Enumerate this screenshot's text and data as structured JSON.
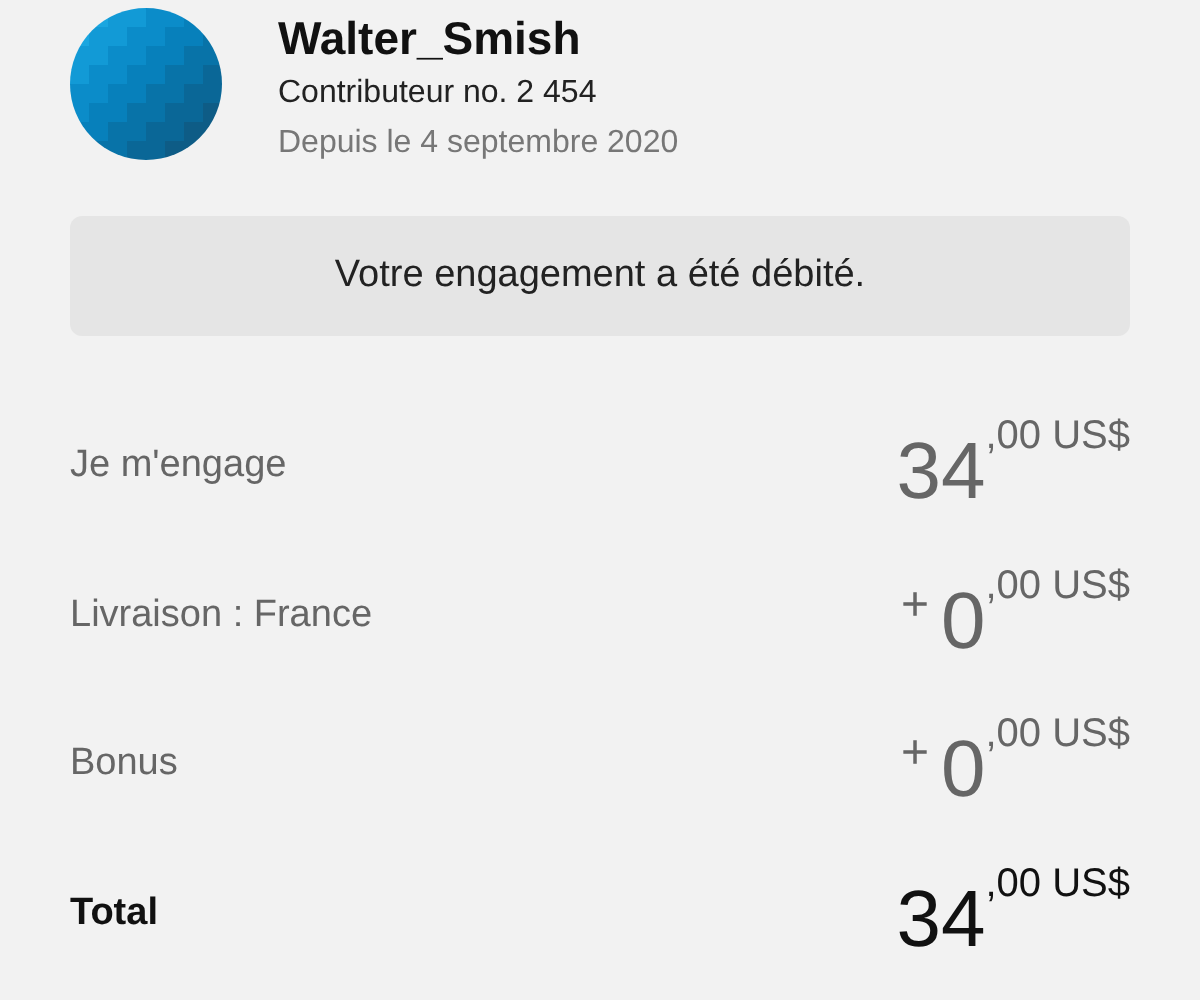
{
  "profile": {
    "name": "Walter_Smish",
    "contributor": "Contributeur no. 2 454",
    "since": "Depuis le 4 septembre 2020"
  },
  "notice": "Votre engagement a été débité.",
  "rows": [
    {
      "kind": "line",
      "label": "Je m'engage",
      "prefix": "",
      "amount": "34",
      "cents": ",00 US$"
    },
    {
      "kind": "line",
      "label": "Livraison : France",
      "prefix": "+",
      "amount": "0",
      "cents": ",00 US$"
    },
    {
      "kind": "line",
      "label": "Bonus",
      "prefix": "+",
      "amount": "0",
      "cents": ",00 US$"
    },
    {
      "kind": "total",
      "label": "Total",
      "prefix": "",
      "amount": "34",
      "cents": ",00 US$"
    }
  ]
}
